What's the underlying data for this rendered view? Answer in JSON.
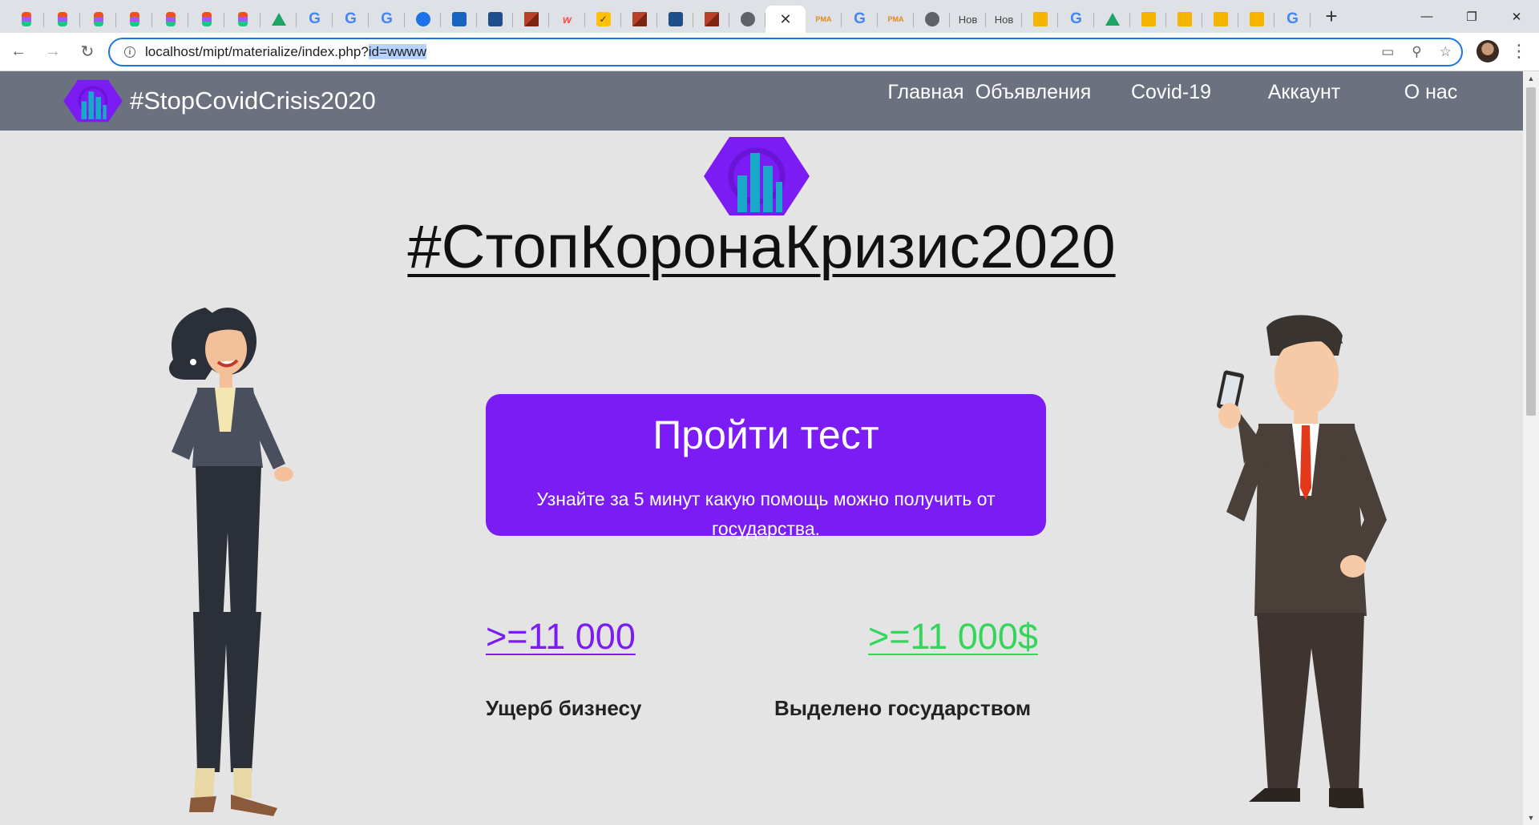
{
  "browser": {
    "tabs": [
      {
        "icon": "figma-icon"
      },
      {
        "icon": "figma-icon"
      },
      {
        "icon": "figma-icon"
      },
      {
        "icon": "figma-icon"
      },
      {
        "icon": "figma-icon"
      },
      {
        "icon": "figma-icon"
      },
      {
        "icon": "figma-icon"
      },
      {
        "icon": "google-drive-icon"
      },
      {
        "icon": "google-icon"
      },
      {
        "icon": "google-icon"
      },
      {
        "icon": "google-icon"
      },
      {
        "icon": "chat-icon"
      },
      {
        "icon": "trello-icon"
      },
      {
        "icon": "stackoverflow-icon"
      },
      {
        "icon": "blocks-icon"
      },
      {
        "icon": "w-icon"
      },
      {
        "icon": "checkbox-icon"
      },
      {
        "icon": "blocks-icon"
      },
      {
        "icon": "stackoverflow-icon"
      },
      {
        "icon": "blocks-icon"
      },
      {
        "icon": "php-icon"
      },
      {
        "icon": "close-icon",
        "active": true
      },
      {
        "icon": "pma-icon"
      },
      {
        "icon": "google-icon"
      },
      {
        "icon": "pma-icon"
      },
      {
        "icon": "globe-icon"
      },
      {
        "icon": "text",
        "text": "Нов"
      },
      {
        "icon": "text",
        "text": "Нов"
      },
      {
        "icon": "slides-icon"
      },
      {
        "icon": "google-icon"
      },
      {
        "icon": "google-drive-icon"
      },
      {
        "icon": "slides-icon"
      },
      {
        "icon": "slides-icon"
      },
      {
        "icon": "slides-icon"
      },
      {
        "icon": "slides-icon"
      },
      {
        "icon": "google-icon"
      }
    ],
    "address": {
      "host": "localhost",
      "path": "/mipt/materialize/index.php?",
      "selected": "id=wwww"
    }
  },
  "site": {
    "brand": "#StopCovidCrisis2020",
    "menu": [
      {
        "label": "Главная"
      },
      {
        "label": "Объявления"
      },
      {
        "label": "Covid-19"
      },
      {
        "label": "Аккаунт"
      },
      {
        "label": "О нас"
      }
    ],
    "hero_title": "#СтопКоронаКризис2020",
    "cta": {
      "title": "Пройти тест",
      "subtitle": "Узнайте за 5 минут какую помощь можно получить от государства."
    },
    "stats": [
      {
        "value": ">=11 000",
        "label": "Ущерб бизнесу",
        "color": "#7b1cf5"
      },
      {
        "value": ">=11 000$",
        "label": "Выделено государством",
        "color": "#33d65a"
      }
    ]
  },
  "colors": {
    "navbar": "#6b717f",
    "accent": "#7b1cf5",
    "page_bg": "#e4e4e4"
  }
}
